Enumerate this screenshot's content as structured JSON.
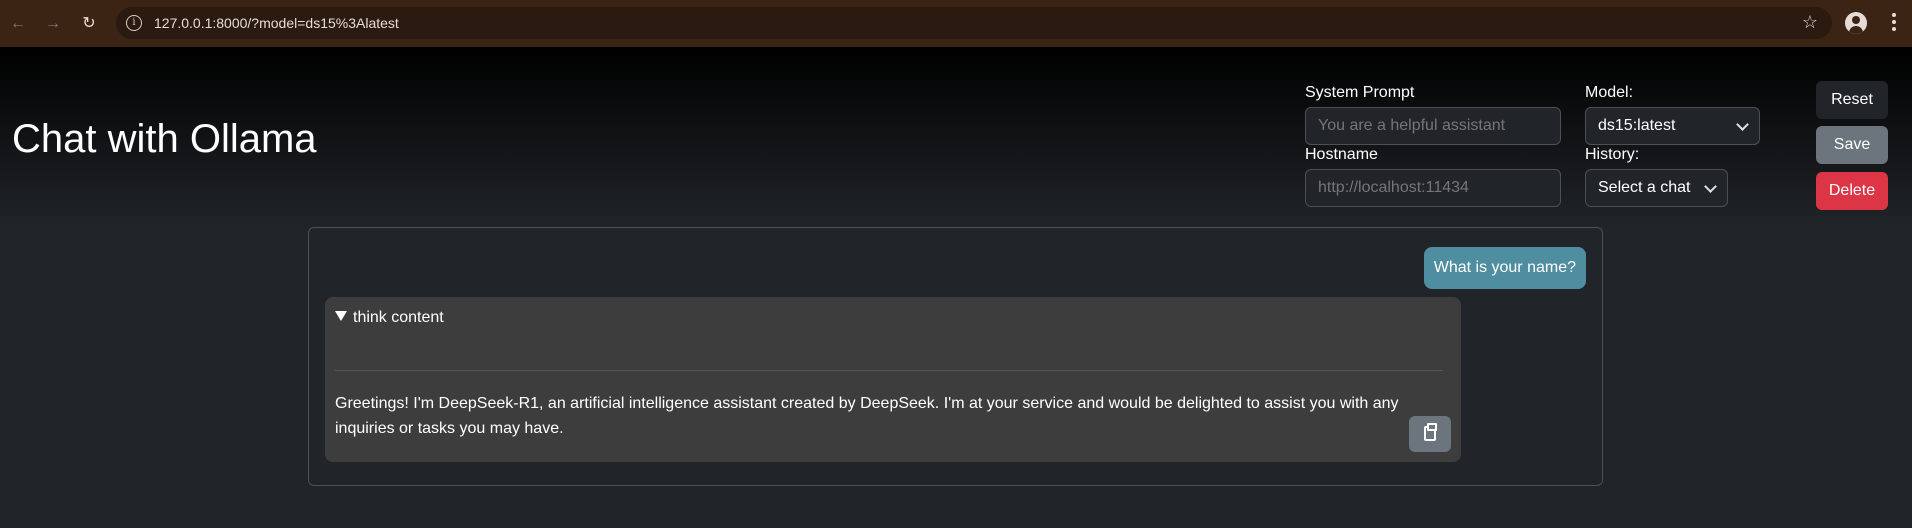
{
  "browser": {
    "url": "127.0.0.1:8000/?model=ds15%3Alatest",
    "back_icon": "←",
    "forward_icon": "→",
    "reload_icon": "↻",
    "info_icon": "i",
    "star_icon": "☆"
  },
  "page": {
    "title": "Chat with Ollama"
  },
  "settings": {
    "system_prompt_label": "System Prompt",
    "system_prompt_placeholder": "You are a helpful assistant",
    "hostname_label": "Hostname",
    "hostname_placeholder": "http://localhost:11434",
    "model_label": "Model:",
    "model_value": "ds15:latest",
    "history_label": "History:",
    "history_value": "Select a chat"
  },
  "buttons": {
    "reset": "Reset",
    "save": "Save",
    "delete": "Delete"
  },
  "colors": {
    "user_bubble": "#4f8ea0",
    "delete": "#dc3545",
    "save": "#6c757d"
  },
  "chat": {
    "user_message": "What is your name?",
    "think_summary": "think content",
    "assistant_message": "Greetings! I'm DeepSeek-R1, an artificial intelligence assistant created by DeepSeek. I'm at your service and would be delighted to assist you with any inquiries or tasks you may have."
  }
}
